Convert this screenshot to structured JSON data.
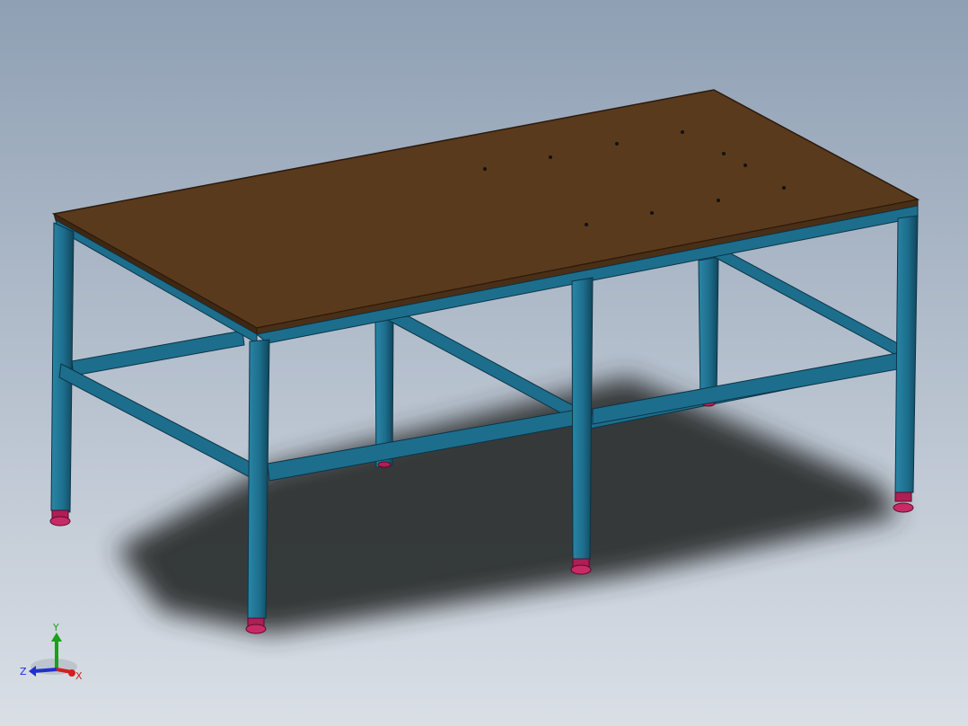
{
  "viewport": {
    "background_top": "#8fa0b4",
    "background_bottom": "#dadfe6"
  },
  "model": {
    "name": "",
    "frame_color": "#1d6e8d",
    "frame_dark": "#0f4459",
    "top_color": "#5a3a1d",
    "foot_color": "#b01e55",
    "shadow_color": "#2f3033"
  },
  "triad": {
    "x_label": "X",
    "y_label": "Y",
    "z_label": "Z",
    "x_color": "#d02020",
    "y_color": "#1aa01a",
    "z_color": "#2030d0"
  }
}
